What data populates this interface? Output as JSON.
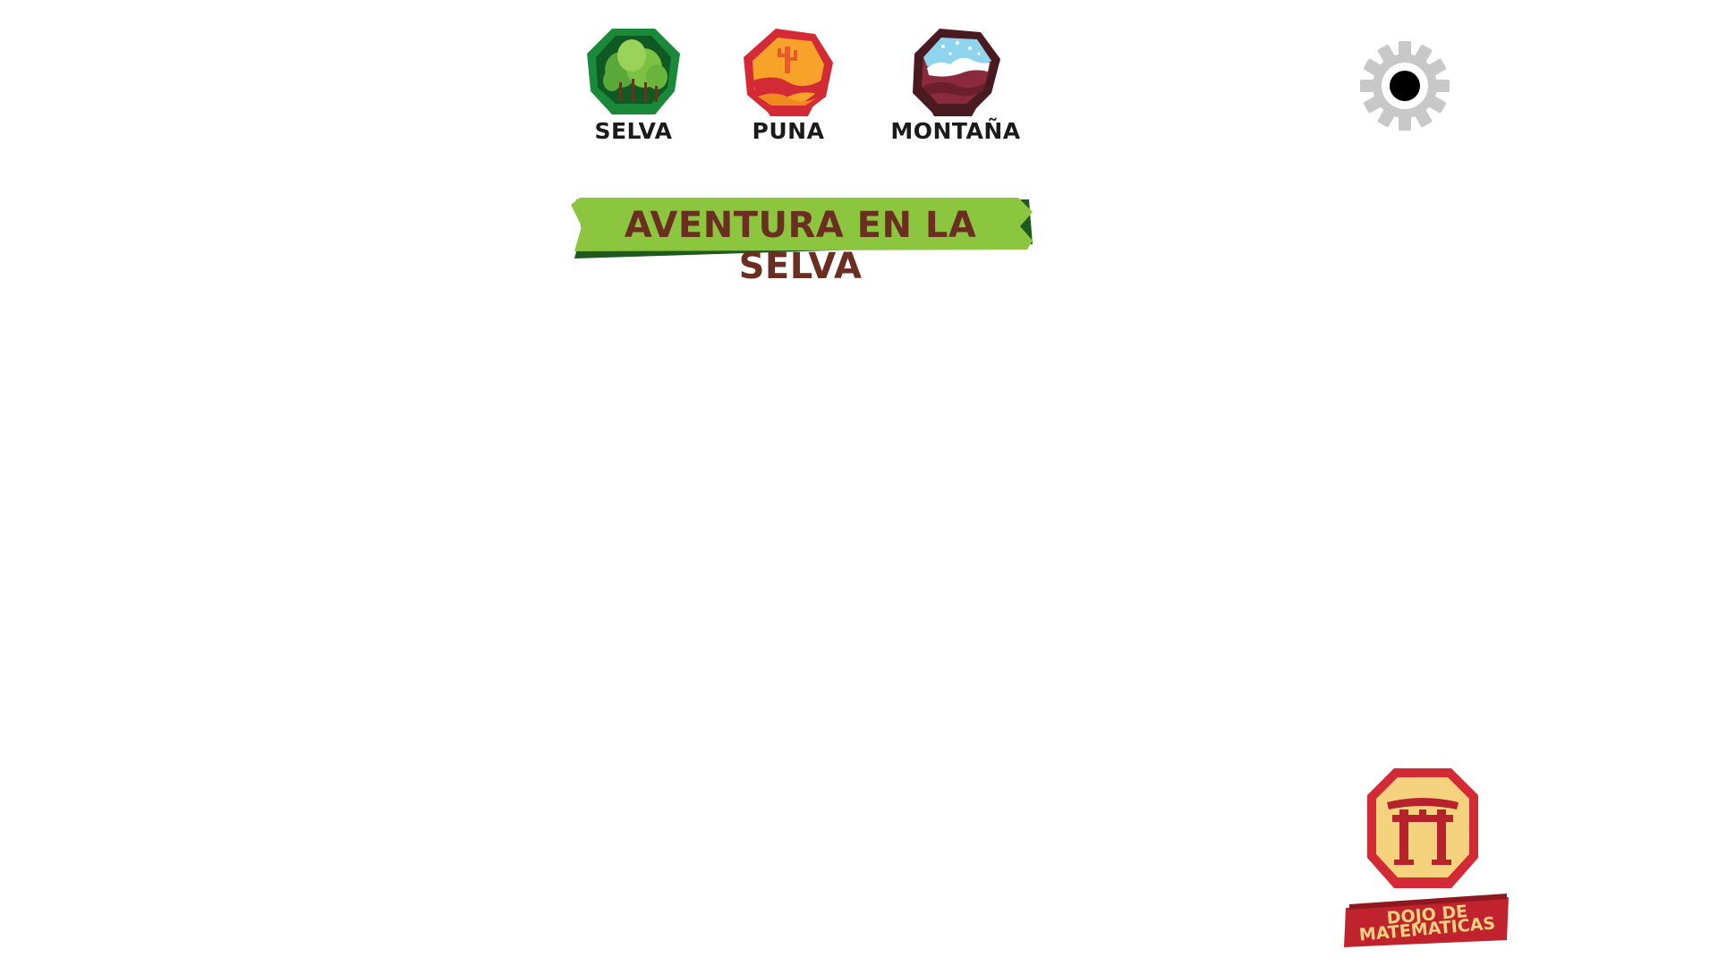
{
  "regions": [
    {
      "label": "SELVA",
      "icon": "jungle-trees-icon",
      "colors": {
        "frame": "#1f8f3a",
        "fill": "#7cc242"
      }
    },
    {
      "label": "PUNA",
      "icon": "desert-cactus-icon",
      "colors": {
        "frame": "#d42a35",
        "fill": "#f7a229"
      }
    },
    {
      "label": "MONTAÑA",
      "icon": "snowy-mountain-icon",
      "colors": {
        "frame": "#4a1a22",
        "fill": "#8b2a3c"
      }
    }
  ],
  "banner": {
    "title": "AVENTURA EN LA SELVA",
    "colors": {
      "ribbon": "#8cc63f",
      "shadow": "#1f5a1f",
      "text": "#6b2f22"
    }
  },
  "settings": {
    "icon": "gear-icon",
    "colors": {
      "gear": "#c8c8c8",
      "center": "#000000"
    }
  },
  "logo": {
    "icon": "torii-gate-icon",
    "line1": "DOJO DE",
    "line2": "MATEMATICAS",
    "colors": {
      "frame": "#d42a35",
      "fill": "#f5d27e"
    }
  }
}
